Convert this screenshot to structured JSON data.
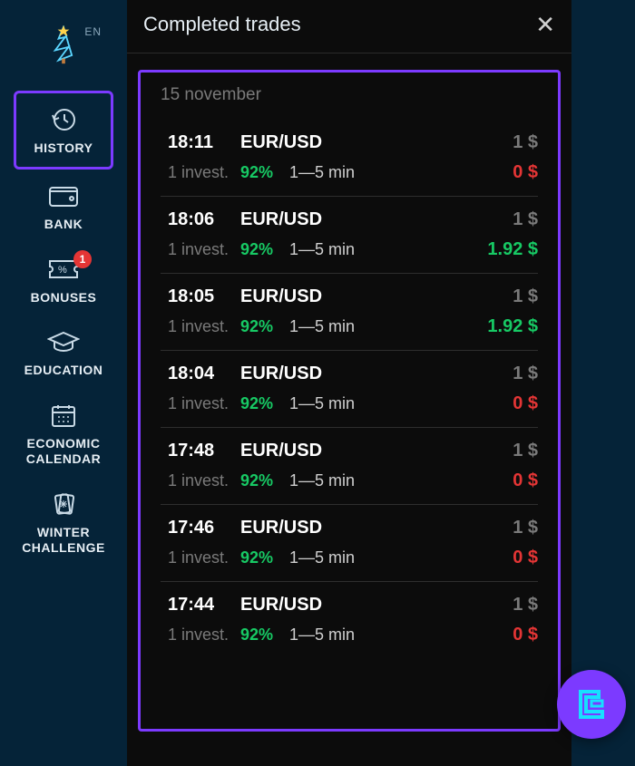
{
  "language": "EN",
  "sidebar": {
    "items": [
      {
        "label": "HISTORY"
      },
      {
        "label": "BANK"
      },
      {
        "label": "BONUSES",
        "badge": "1"
      },
      {
        "label": "EDUCATION"
      },
      {
        "label": "ECONOMIC CALENDAR"
      },
      {
        "label": "WINTER CHALLENGE"
      }
    ]
  },
  "panel": {
    "title": "Completed trades",
    "date": "15 november",
    "trades": [
      {
        "time": "18:11",
        "pair": "EUR/USD",
        "amount": "1 $",
        "invest": "1 invest.",
        "pct": "92%",
        "duration": "1—5 min",
        "result": "0 $",
        "status": "lose"
      },
      {
        "time": "18:06",
        "pair": "EUR/USD",
        "amount": "1 $",
        "invest": "1 invest.",
        "pct": "92%",
        "duration": "1—5 min",
        "result": "1.92 $",
        "status": "win"
      },
      {
        "time": "18:05",
        "pair": "EUR/USD",
        "amount": "1 $",
        "invest": "1 invest.",
        "pct": "92%",
        "duration": "1—5 min",
        "result": "1.92 $",
        "status": "win"
      },
      {
        "time": "18:04",
        "pair": "EUR/USD",
        "amount": "1 $",
        "invest": "1 invest.",
        "pct": "92%",
        "duration": "1—5 min",
        "result": "0 $",
        "status": "lose"
      },
      {
        "time": "17:48",
        "pair": "EUR/USD",
        "amount": "1 $",
        "invest": "1 invest.",
        "pct": "92%",
        "duration": "1—5 min",
        "result": "0 $",
        "status": "lose"
      },
      {
        "time": "17:46",
        "pair": "EUR/USD",
        "amount": "1 $",
        "invest": "1 invest.",
        "pct": "92%",
        "duration": "1—5 min",
        "result": "0 $",
        "status": "lose"
      },
      {
        "time": "17:44",
        "pair": "EUR/USD",
        "amount": "1 $",
        "invest": "1 invest.",
        "pct": "92%",
        "duration": "1—5 min",
        "result": "0 $",
        "status": "lose"
      }
    ]
  }
}
